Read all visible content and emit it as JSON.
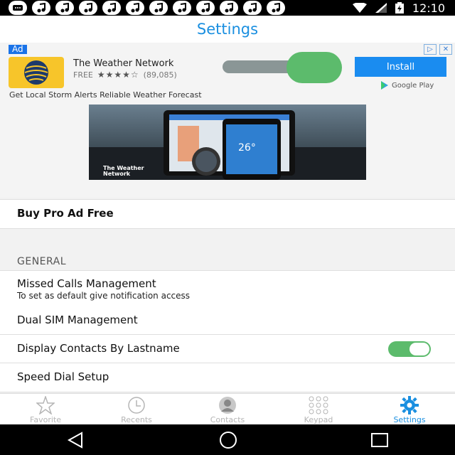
{
  "status_bar": {
    "time": "12:10",
    "notification_icons": [
      "music-note-icon",
      "music-note-icon",
      "music-note-icon",
      "music-note-icon",
      "music-note-icon",
      "music-note-icon",
      "music-note-icon",
      "music-note-icon",
      "music-note-icon",
      "music-note-icon",
      "music-note-icon",
      "music-note-icon"
    ]
  },
  "header": {
    "title": "Settings"
  },
  "ad": {
    "badge": "Ad",
    "app_name": "The Weather Network",
    "price": "FREE",
    "rating_stars": "★★★★☆",
    "rating_count": "(89,085)",
    "install_label": "Install",
    "store_label": "Google Play",
    "tagline": "Get Local Storm Alerts Reliable Weather Forecast",
    "image_logo_line1": "The Weather",
    "image_logo_line2": "Network",
    "image_temp": "26°",
    "colors": {
      "accent": "#1a8cf0",
      "badge": "#1a73e8",
      "app_icon_bg": "#f7c52a"
    }
  },
  "settings": {
    "buy_pro": "Buy Pro Ad Free",
    "section_general": "GENERAL",
    "missed_calls": {
      "title": "Missed Calls Management",
      "subtitle": "To set as default give notification access"
    },
    "dual_sim": "Dual SIM Management",
    "display_lastname": {
      "title": "Display Contacts By Lastname",
      "toggle_on": true
    },
    "speed_dial": "Speed Dial Setup"
  },
  "tabs": [
    {
      "label": "Favorite",
      "icon": "star-icon",
      "active": false
    },
    {
      "label": "Recents",
      "icon": "clock-icon",
      "active": false
    },
    {
      "label": "Contacts",
      "icon": "person-icon",
      "active": false
    },
    {
      "label": "Keypad",
      "icon": "keypad-icon",
      "active": false
    },
    {
      "label": "Settings",
      "icon": "gear-icon",
      "active": true
    }
  ],
  "colors": {
    "primary": "#1a8fe0",
    "toggle_on": "#5cbb6c",
    "inactive": "#b5b5b5"
  }
}
